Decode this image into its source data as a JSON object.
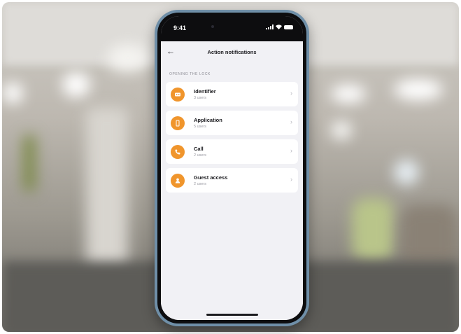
{
  "status": {
    "time": "9:41"
  },
  "header": {
    "back_icon": "arrow-left-icon",
    "title": "Action notifications"
  },
  "section_label": "OPENING THE LOCK",
  "items": [
    {
      "name": "Identifier",
      "count": "3 users",
      "icon": "id-card-icon"
    },
    {
      "name": "Application",
      "count": "5 users",
      "icon": "smartphone-icon"
    },
    {
      "name": "Call",
      "count": "2 users",
      "icon": "phone-call-icon"
    },
    {
      "name": "Guest access",
      "count": "2 users",
      "icon": "person-icon"
    }
  ],
  "colors": {
    "accent": "#f0952c",
    "screen_bg": "#f1f1f5",
    "phone_frame": "#6f8fa8"
  }
}
